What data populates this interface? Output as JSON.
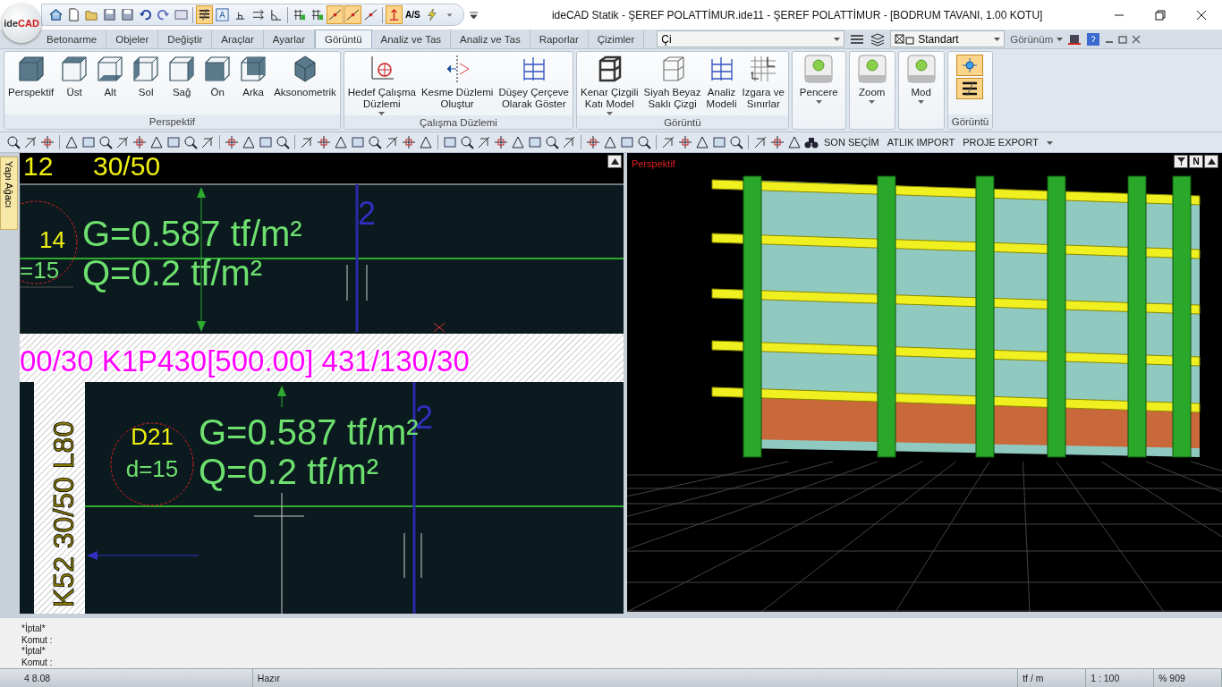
{
  "logo": {
    "prefix": "ide",
    "suffix": "CAD"
  },
  "quick_access": [
    {
      "kind": "home",
      "on": false
    },
    {
      "kind": "new",
      "on": false
    },
    {
      "kind": "open",
      "on": false
    },
    {
      "kind": "save",
      "on": false
    },
    {
      "kind": "saveall",
      "on": false
    },
    {
      "kind": "undo",
      "on": false
    },
    {
      "kind": "redo",
      "on": false
    },
    {
      "kind": "restore",
      "on": false
    },
    {
      "kind": "sep"
    },
    {
      "kind": "layers",
      "on": true
    },
    {
      "kind": "textbox",
      "on": false
    },
    {
      "kind": "dim",
      "on": false
    },
    {
      "kind": "arrows",
      "on": false
    },
    {
      "kind": "angle",
      "on": false
    },
    {
      "kind": "sep"
    },
    {
      "kind": "gridlock",
      "on": false
    },
    {
      "kind": "snaplock",
      "on": false
    },
    {
      "kind": "snap",
      "on": true
    },
    {
      "kind": "snap",
      "on": true
    },
    {
      "kind": "snap",
      "on": false
    },
    {
      "kind": "sep"
    },
    {
      "kind": "ortho",
      "on": true
    },
    {
      "kind": "label",
      "on": false,
      "label": "A/S"
    },
    {
      "kind": "bolt",
      "on": false
    },
    {
      "kind": "caret",
      "on": false
    }
  ],
  "window": {
    "title": "ideCAD Statik - ŞEREF POLATTİMUR.ide11 - ŞEREF POLATTİMUR - [BODRUM TAVANI,  1.00 KOTU]"
  },
  "tabs": [
    {
      "label": "Betonarme",
      "selected": false
    },
    {
      "label": "Objeler",
      "selected": false
    },
    {
      "label": "Değiştir",
      "selected": false
    },
    {
      "label": "Araçlar",
      "selected": false
    },
    {
      "label": "Ayarlar",
      "selected": false
    },
    {
      "label": "Görüntü",
      "selected": true
    },
    {
      "label": "Analiz ve Tas",
      "selected": false
    },
    {
      "label": "Analiz ve Tas",
      "selected": false
    },
    {
      "label": "Raporlar",
      "selected": false
    },
    {
      "label": "Çizimler",
      "selected": false
    }
  ],
  "command_field": {
    "value": "Çi"
  },
  "style_dropdown": {
    "value": "Standart"
  },
  "view_menu": {
    "label": "Görünüm"
  },
  "ribbon_groups": [
    {
      "title": "Perspektif",
      "buttons": [
        {
          "kind": "cube-solid",
          "lines": [
            "Perspektif"
          ],
          "dropdown": false
        },
        {
          "kind": "cube-top",
          "lines": [
            "Üst"
          ],
          "dropdown": false
        },
        {
          "kind": "cube-bottom",
          "lines": [
            "Alt"
          ],
          "dropdown": false
        },
        {
          "kind": "cube-left",
          "lines": [
            "Sol"
          ],
          "dropdown": false
        },
        {
          "kind": "cube-right",
          "lines": [
            "Sağ"
          ],
          "dropdown": false
        },
        {
          "kind": "cube-front",
          "lines": [
            "Ön"
          ],
          "dropdown": false
        },
        {
          "kind": "cube-back",
          "lines": [
            "Arka"
          ],
          "dropdown": false
        },
        {
          "kind": "axono",
          "lines": [
            "Aksonometrik"
          ],
          "dropdown": false
        }
      ]
    },
    {
      "title": "Çalışma Düzlemi",
      "buttons": [
        {
          "kind": "target",
          "lines": [
            "Hedef Çalışma",
            "Düzlemi"
          ],
          "dropdown": true
        },
        {
          "kind": "cut",
          "lines": [
            "Kesme Düzlemi",
            "Oluştur"
          ],
          "dropdown": false
        },
        {
          "kind": "frame",
          "lines": [
            "Düşey Çerçeve",
            "Olarak Göster"
          ],
          "dropdown": false
        }
      ]
    },
    {
      "title": "Görüntü",
      "buttons": [
        {
          "kind": "solidframe",
          "lines": [
            "Kenar Çizgili",
            "Katı Model"
          ],
          "dropdown": true
        },
        {
          "kind": "wireframe",
          "lines": [
            "Siyah Beyaz",
            "Saklı Çizgi"
          ],
          "dropdown": false
        },
        {
          "kind": "analysis",
          "lines": [
            "Analiz",
            "Modeli"
          ],
          "dropdown": false
        },
        {
          "kind": "grid",
          "lines": [
            "Izgara ve",
            "Sınırlar"
          ],
          "dropdown": false
        }
      ]
    },
    {
      "buttons": [
        {
          "kind": "lamp",
          "lines": [
            "Pencere"
          ],
          "dropdown": true
        }
      ]
    },
    {
      "buttons": [
        {
          "kind": "lamp",
          "lines": [
            "Zoom"
          ],
          "dropdown": true
        }
      ]
    },
    {
      "buttons": [
        {
          "kind": "lamp",
          "lines": [
            "Mod"
          ],
          "dropdown": true
        }
      ]
    },
    {
      "title": "Görüntü",
      "buttons": [
        {
          "kind": "pin",
          "on": true
        },
        {
          "kind": "layers",
          "on": true
        }
      ]
    }
  ],
  "toolbar": {
    "text_buttons": [
      "SON SEÇİM",
      "ATLIK IMPORT",
      "PROJE EXPORT"
    ]
  },
  "side_panel": {
    "label": "Yapı Ağacı"
  },
  "plan_view": {
    "top_texts": [
      "12",
      "30/50"
    ],
    "slab_top": {
      "id_text": "14",
      "thickness": "=15",
      "g": "G=0.587 tf/m²",
      "q": "Q=0.2 tf/m²",
      "axis": "2"
    },
    "beam_text": "00/30  K1P430[500.00]  431/130/30",
    "column_text": "K52 30/50 L80",
    "slab_bottom": {
      "id_text": "D21",
      "thickness": "d=15",
      "g": "G=0.587 tf/m²",
      "q": "Q=0.2 tf/m²",
      "axis": "2"
    }
  },
  "model_view": {
    "label": "Perspektif",
    "corner_label": "N"
  },
  "command_log": [
    "*İptal*",
    "Komut :",
    "*İptal*",
    "Komut :"
  ],
  "status_bar": [
    "4 8.08",
    "Hazır",
    "tf / m",
    "1 : 100",
    "% 909"
  ]
}
